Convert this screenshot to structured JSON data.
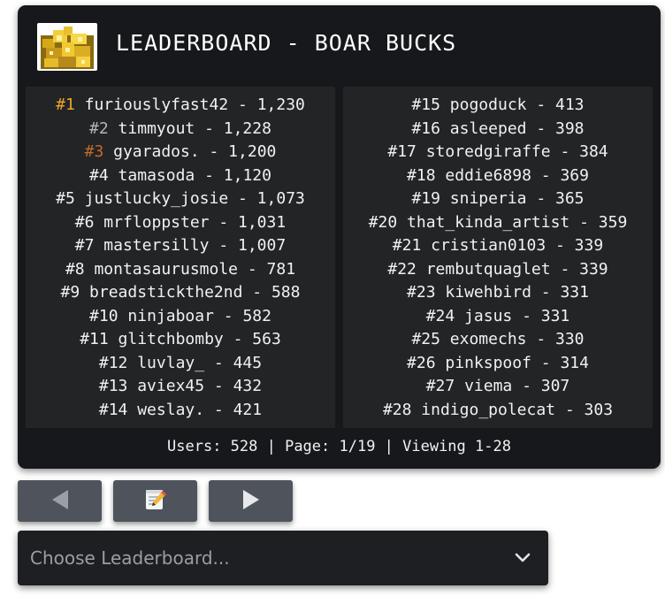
{
  "header": {
    "title": "LEADERBOARD - BOAR BUCKS",
    "avatar_icon": "gold-coins-pile-icon"
  },
  "leaderboard": {
    "left": [
      {
        "rank": "#1",
        "text": " furiouslyfast42 - 1,230",
        "medal": "gold"
      },
      {
        "rank": "#2",
        "text": " timmyout - 1,228",
        "medal": "silver"
      },
      {
        "rank": "#3",
        "text": " gyarados. - 1,200",
        "medal": "bronze"
      },
      {
        "rank": "",
        "text": "#4 tamasoda - 1,120",
        "medal": ""
      },
      {
        "rank": "",
        "text": "#5 justlucky_josie - 1,073",
        "medal": ""
      },
      {
        "rank": "",
        "text": "#6 mrfloppster - 1,031",
        "medal": ""
      },
      {
        "rank": "",
        "text": "#7 mastersilly - 1,007",
        "medal": ""
      },
      {
        "rank": "",
        "text": "#8 montasaurusmole - 781",
        "medal": ""
      },
      {
        "rank": "",
        "text": "#9 breadstickthe2nd - 588",
        "medal": ""
      },
      {
        "rank": "",
        "text": "#10 ninjaboar - 582",
        "medal": ""
      },
      {
        "rank": "",
        "text": "#11 glitchbomby - 563",
        "medal": ""
      },
      {
        "rank": "",
        "text": "#12 luvlay_ - 445",
        "medal": ""
      },
      {
        "rank": "",
        "text": "#13 aviex45 - 432",
        "medal": ""
      },
      {
        "rank": "",
        "text": "#14 weslay. - 421",
        "medal": ""
      }
    ],
    "right": [
      {
        "rank": "",
        "text": "#15 pogoduck - 413",
        "medal": ""
      },
      {
        "rank": "",
        "text": "#16 asleeped - 398",
        "medal": ""
      },
      {
        "rank": "",
        "text": "#17 storedgiraffe - 384",
        "medal": ""
      },
      {
        "rank": "",
        "text": "#18 eddie6898 - 369",
        "medal": ""
      },
      {
        "rank": "",
        "text": "#19 sniperia - 365",
        "medal": ""
      },
      {
        "rank": "",
        "text": "#20 that_kinda_artist - 359",
        "medal": ""
      },
      {
        "rank": "",
        "text": "#21 cristian0103 - 339",
        "medal": ""
      },
      {
        "rank": "",
        "text": "#22 rembutquaglet - 339",
        "medal": ""
      },
      {
        "rank": "",
        "text": "#23 kiwehbird - 331",
        "medal": ""
      },
      {
        "rank": "",
        "text": "#24 jasus - 331",
        "medal": ""
      },
      {
        "rank": "",
        "text": "#25 exomechs - 330",
        "medal": ""
      },
      {
        "rank": "",
        "text": "#26 pinkspoof - 314",
        "medal": ""
      },
      {
        "rank": "",
        "text": "#27 viema - 307",
        "medal": ""
      },
      {
        "rank": "",
        "text": "#28 indigo_polecat - 303",
        "medal": ""
      }
    ]
  },
  "footer": {
    "text": "Users: 528 | Page: 1/19 | Viewing 1-28"
  },
  "controls": {
    "prev_icon": "left-arrow-icon",
    "edit_icon": "memo-pencil-icon",
    "next_icon": "right-arrow-icon"
  },
  "select": {
    "placeholder": "Choose Leaderboard...",
    "icon": "chevron-down-icon"
  },
  "colors": {
    "card_bg": "#17181b",
    "panel_bg": "#222426",
    "text": "#f1f1f1",
    "gold": "#f0a424",
    "silver": "#b5b5b5",
    "bronze": "#c46a2a",
    "button_bg": "#4f545c"
  }
}
